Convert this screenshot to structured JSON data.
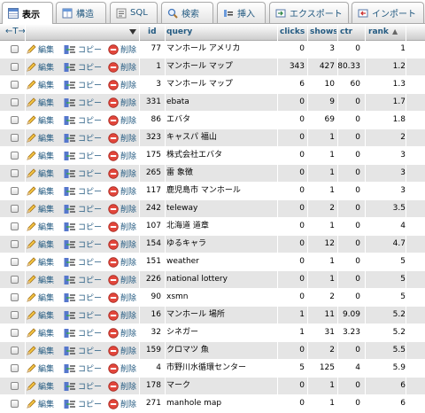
{
  "tabs": [
    {
      "label": "表示",
      "icon": "browse-icon"
    },
    {
      "label": "構造",
      "icon": "structure-icon"
    },
    {
      "label": "SQL",
      "icon": "sql-icon"
    },
    {
      "label": "検索",
      "icon": "search-icon"
    },
    {
      "label": "挿入",
      "icon": "insert-icon"
    },
    {
      "label": "エクスポート",
      "icon": "export-icon"
    },
    {
      "label": "インポート",
      "icon": "import-icon"
    }
  ],
  "header": {
    "arrows": "←T→",
    "columns": [
      "id",
      "query",
      "clicks",
      "shows",
      "ctr",
      "rank"
    ],
    "sort_indicator": "▲"
  },
  "actions": {
    "edit": "編集",
    "copy": "コピー",
    "delete": "削除"
  },
  "rows": [
    {
      "id": "77",
      "query": "マンホール アメリカ",
      "clicks": "0",
      "shows": "3",
      "ctr": "0",
      "rank": "1"
    },
    {
      "id": "1",
      "query": "マンホール マップ",
      "clicks": "343",
      "shows": "427",
      "ctr": "80.33",
      "rank": "1.2"
    },
    {
      "id": "3",
      "query": "マンホール マップ",
      "clicks": "6",
      "shows": "10",
      "ctr": "60",
      "rank": "1.3"
    },
    {
      "id": "331",
      "query": "ebata",
      "clicks": "0",
      "shows": "9",
      "ctr": "0",
      "rank": "1.7"
    },
    {
      "id": "86",
      "query": "エバタ",
      "clicks": "0",
      "shows": "69",
      "ctr": "0",
      "rank": "1.8"
    },
    {
      "id": "323",
      "query": "キャスパ 福山",
      "clicks": "0",
      "shows": "1",
      "ctr": "0",
      "rank": "2"
    },
    {
      "id": "175",
      "query": "株式会社エバタ",
      "clicks": "0",
      "shows": "1",
      "ctr": "0",
      "rank": "3"
    },
    {
      "id": "265",
      "query": "雷 象徴",
      "clicks": "0",
      "shows": "1",
      "ctr": "0",
      "rank": "3"
    },
    {
      "id": "117",
      "query": "鹿児島市 マンホール",
      "clicks": "0",
      "shows": "1",
      "ctr": "0",
      "rank": "3"
    },
    {
      "id": "242",
      "query": "teleway",
      "clicks": "0",
      "shows": "2",
      "ctr": "0",
      "rank": "3.5"
    },
    {
      "id": "107",
      "query": "北海道 道章",
      "clicks": "0",
      "shows": "1",
      "ctr": "0",
      "rank": "4"
    },
    {
      "id": "154",
      "query": "ゆるキャラ",
      "clicks": "0",
      "shows": "12",
      "ctr": "0",
      "rank": "4.7"
    },
    {
      "id": "151",
      "query": "weather",
      "clicks": "0",
      "shows": "1",
      "ctr": "0",
      "rank": "5"
    },
    {
      "id": "226",
      "query": "national lottery",
      "clicks": "0",
      "shows": "1",
      "ctr": "0",
      "rank": "5"
    },
    {
      "id": "90",
      "query": "xsmn",
      "clicks": "0",
      "shows": "2",
      "ctr": "0",
      "rank": "5"
    },
    {
      "id": "16",
      "query": "マンホール 場所",
      "clicks": "1",
      "shows": "11",
      "ctr": "9.09",
      "rank": "5.2"
    },
    {
      "id": "32",
      "query": "シネガー",
      "clicks": "1",
      "shows": "31",
      "ctr": "3.23",
      "rank": "5.2"
    },
    {
      "id": "159",
      "query": "クロマツ 魚",
      "clicks": "0",
      "shows": "2",
      "ctr": "0",
      "rank": "5.5"
    },
    {
      "id": "4",
      "query": "市野川水循環センター",
      "clicks": "5",
      "shows": "125",
      "ctr": "4",
      "rank": "5.9"
    },
    {
      "id": "178",
      "query": "マーク",
      "clicks": "0",
      "shows": "1",
      "ctr": "0",
      "rank": "6"
    },
    {
      "id": "271",
      "query": "manhole map",
      "clicks": "0",
      "shows": "1",
      "ctr": "0",
      "rank": "6"
    }
  ]
}
